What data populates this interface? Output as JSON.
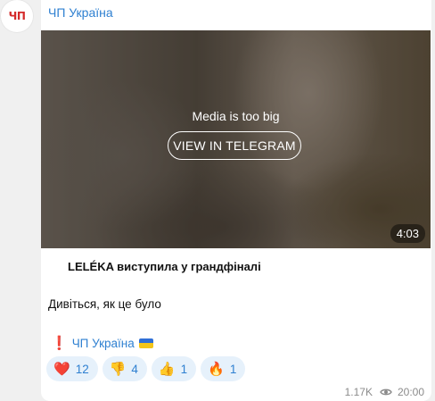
{
  "channel": {
    "avatar_text": "ЧП",
    "name": "ЧП Україна"
  },
  "media": {
    "message": "Media is too big",
    "button_label": "VIEW IN TELEGRAM",
    "duration": "4:03"
  },
  "post": {
    "headline": "LELÉKA виступила у грандфіналі",
    "body": "Дивіться, як це було",
    "signature_mark": "❗",
    "signature": "ЧП Україна"
  },
  "reactions": [
    {
      "emoji": "❤️",
      "count": "12"
    },
    {
      "emoji": "👎",
      "count": "4"
    },
    {
      "emoji": "👍",
      "count": "1"
    },
    {
      "emoji": "🔥",
      "count": "1"
    }
  ],
  "footer": {
    "views": "1.17K",
    "time": "20:00",
    "view_icon": "eye-icon"
  },
  "colors": {
    "link": "#2f80d1",
    "reaction_bg": "#e6f1fb",
    "avatar_red": "#d42a2a"
  }
}
